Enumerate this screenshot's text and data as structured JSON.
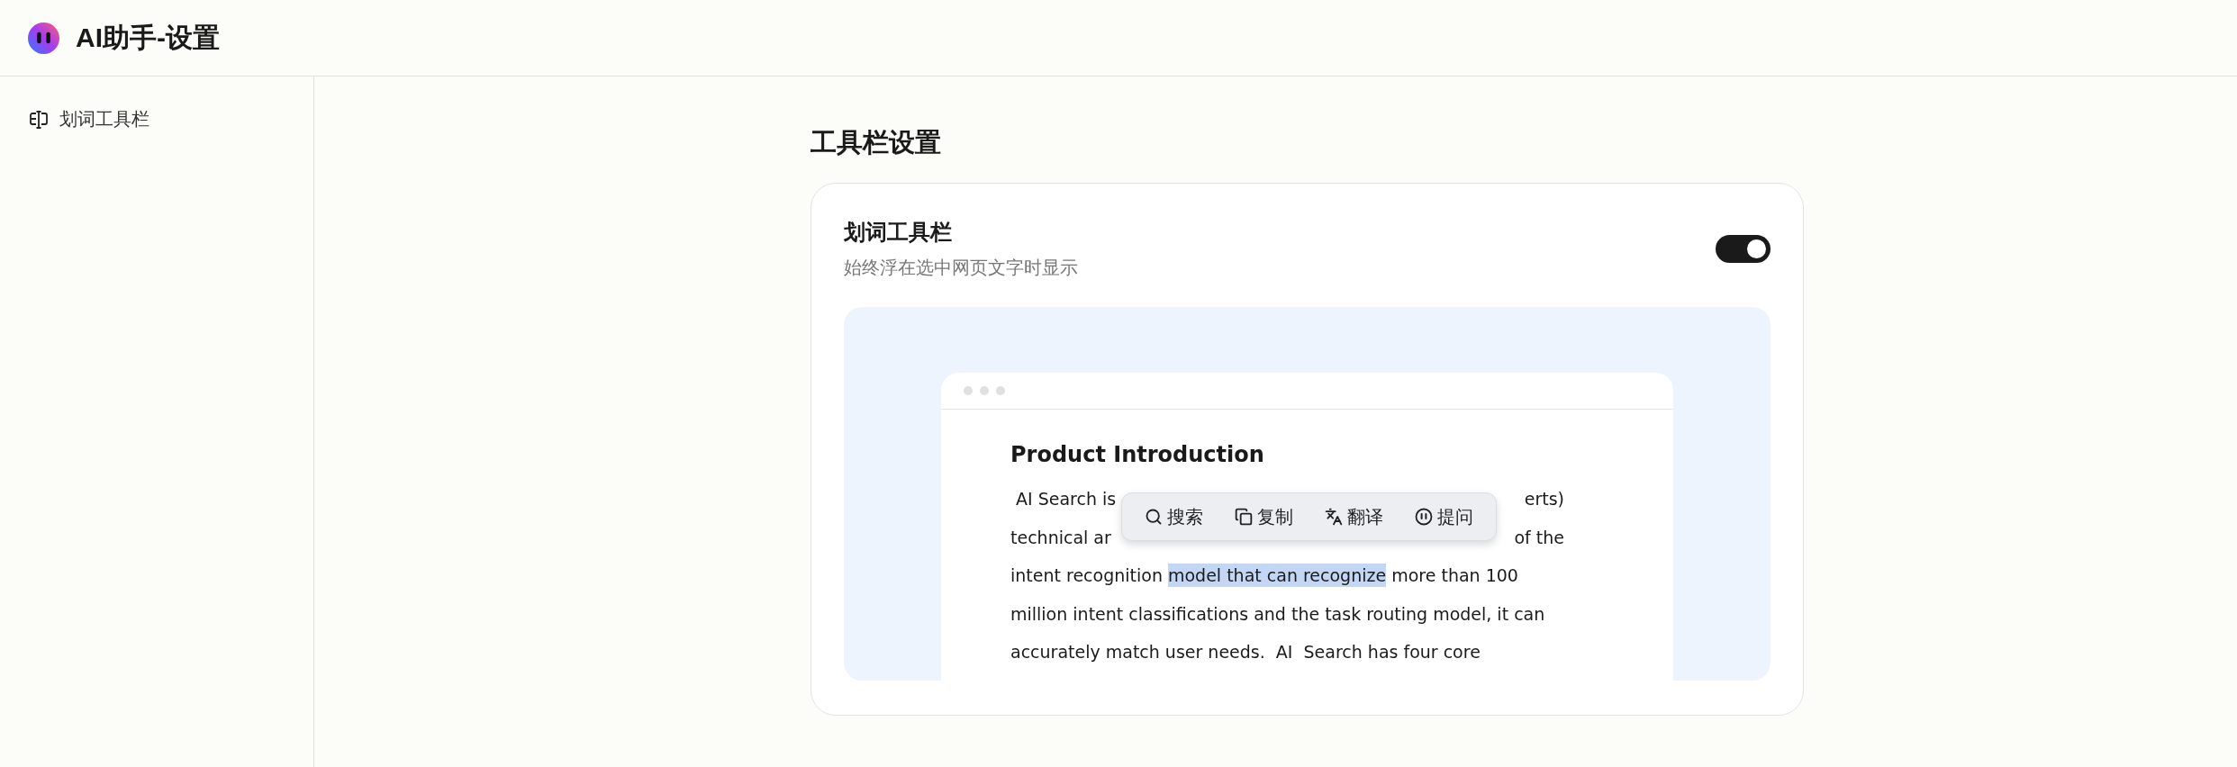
{
  "header": {
    "title": "AI助手-设置"
  },
  "sidebar": {
    "items": [
      {
        "label": "划词工具栏"
      }
    ]
  },
  "section_title": "工具栏设置",
  "setting": {
    "title": "划词工具栏",
    "description": "始终浮在选中网页文字时显示",
    "on": true
  },
  "preview": {
    "heading": "Product Introduction",
    "lines": [
      {
        "kind": "split",
        "left": " AI Search is",
        "right": "erts)"
      },
      {
        "kind": "split",
        "left": "technical ar",
        "right": "of the"
      },
      {
        "kind": "selection",
        "before": "intent recognition ",
        "selected": "model that can recognize",
        "after": " more than 100"
      },
      {
        "kind": "plain",
        "text": "million intent classifications and the task routing model, it can"
      },
      {
        "kind": "plain",
        "text": "accurately match user needs.  AI  Search has four core"
      }
    ],
    "toolbar": [
      {
        "kind": "search",
        "label": "搜索"
      },
      {
        "kind": "copy",
        "label": "复制"
      },
      {
        "kind": "translate",
        "label": "翻译"
      },
      {
        "kind": "ask",
        "label": "提问"
      }
    ]
  }
}
